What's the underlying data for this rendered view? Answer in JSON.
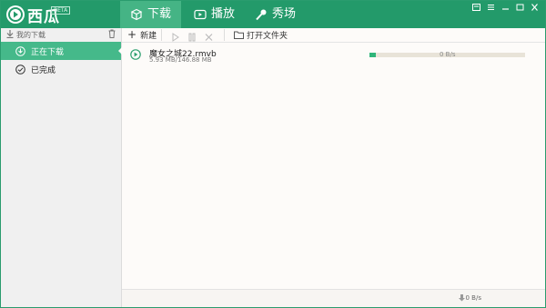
{
  "app": {
    "name": "西瓜",
    "badge": "BETA"
  },
  "nav": {
    "tabs": [
      {
        "label": "下载",
        "icon": "box-download-icon",
        "active": true
      },
      {
        "label": "播放",
        "icon": "play-screen-icon",
        "active": false
      },
      {
        "label": "秀场",
        "icon": "microphone-icon",
        "active": false
      }
    ]
  },
  "sidebar": {
    "header": "我的下载",
    "items": [
      {
        "label": "正在下载",
        "icon": "download-circle-icon",
        "active": true
      },
      {
        "label": "已完成",
        "icon": "check-circle-icon",
        "active": false
      }
    ]
  },
  "toolbar": {
    "new_label": "新建",
    "open_folder_label": "打开文件夹"
  },
  "tasks": [
    {
      "name": "魔女之城22.rmvb",
      "size": "5.93 MB/146.88 MB",
      "speed": "0 B/s",
      "progress": 0.04
    }
  ],
  "status": {
    "total_speed": "0 B/s"
  },
  "colors": {
    "accent": "#239a6a",
    "tab_active": "#45b485",
    "progress": "#2fb57a"
  }
}
